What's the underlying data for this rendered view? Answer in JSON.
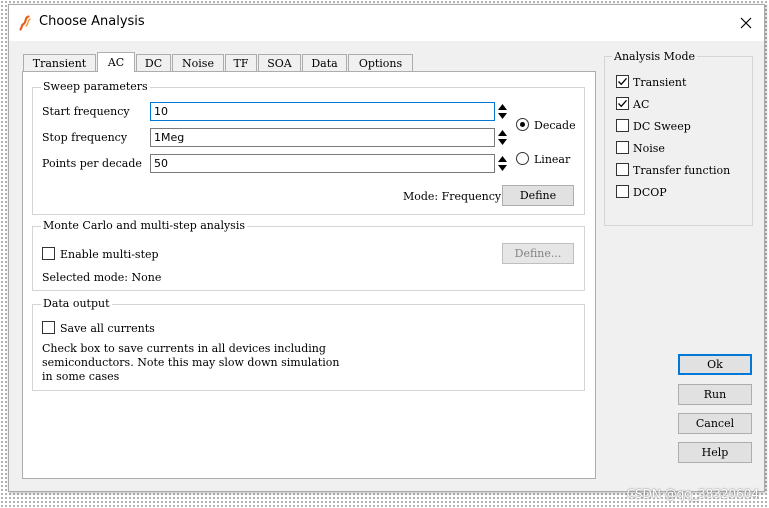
{
  "window": {
    "title": "Choose Analysis"
  },
  "tabs": [
    {
      "label": "Transient"
    },
    {
      "label": "AC"
    },
    {
      "label": "DC"
    },
    {
      "label": "Noise"
    },
    {
      "label": "TF"
    },
    {
      "label": "SOA"
    },
    {
      "label": "Data"
    },
    {
      "label": "Options"
    }
  ],
  "active_tab": "AC",
  "sweep": {
    "group_label": "Sweep parameters",
    "start_label": "Start frequency",
    "start_value": "10",
    "stop_label": "Stop frequency",
    "stop_value": "1Meg",
    "points_label": "Points per decade",
    "points_value": "50",
    "decade_label": "Decade",
    "linear_label": "Linear",
    "selected_scale": "Decade",
    "mode_text": "Mode: Frequency",
    "define_label": "Define"
  },
  "monte_carlo": {
    "group_label": "Monte Carlo and multi-step analysis",
    "enable_label": "Enable multi-step",
    "enable_checked": false,
    "define_label": "Define...",
    "selected_mode_text": "Selected mode: None"
  },
  "data_output": {
    "group_label": "Data output",
    "save_label": "Save all currents",
    "save_checked": false,
    "note_line1": "Check box to save currents in all devices including",
    "note_line2": "semiconductors. Note this may slow down simulation",
    "note_line3": "in some cases"
  },
  "analysis_mode": {
    "title": "Analysis Mode",
    "items": [
      {
        "label": "Transient",
        "checked": true
      },
      {
        "label": "AC",
        "checked": true
      },
      {
        "label": "DC Sweep",
        "checked": false
      },
      {
        "label": "Noise",
        "checked": false
      },
      {
        "label": "Transfer function",
        "checked": false
      },
      {
        "label": "DCOP",
        "checked": false
      }
    ]
  },
  "buttons": {
    "ok": "Ok",
    "run": "Run",
    "cancel": "Cancel",
    "help": "Help"
  },
  "watermark": "CSDN @qq_38320604",
  "colors": {
    "focus": "#0078d7",
    "window_bg": "#f0f0f0",
    "app_icon": "#e8601c"
  },
  "icons": {
    "app": "simetrix-app-icon",
    "close": "close-icon",
    "check": "checkmark-icon",
    "spin_up": "spin-up-icon",
    "spin_down": "spin-down-icon"
  }
}
